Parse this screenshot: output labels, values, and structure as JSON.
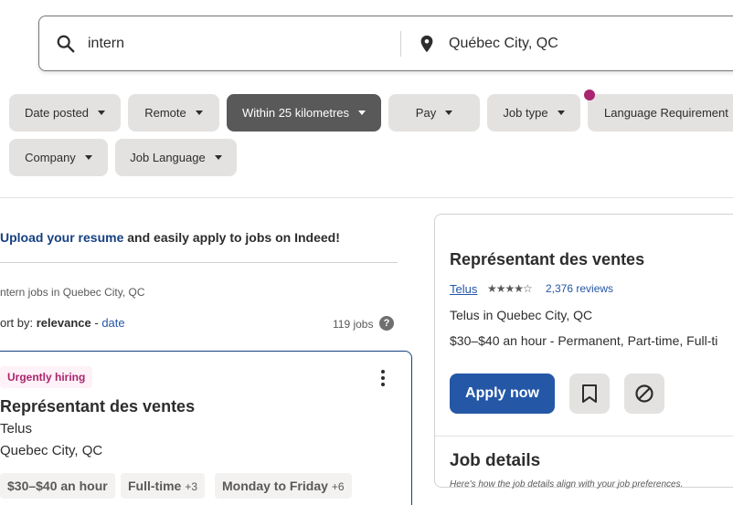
{
  "search": {
    "query": "intern",
    "location": "Québec City, QC"
  },
  "filters": {
    "date_posted": "Date posted",
    "remote": "Remote",
    "distance": "Within 25 kilometres",
    "pay": "Pay",
    "job_type": "Job type",
    "language_requirement": "Language Requirement",
    "company": "Company",
    "job_language": "Job Language"
  },
  "banner": {
    "link": "Upload your resume",
    "text": " and easily apply to jobs on Indeed!"
  },
  "results": {
    "breadcrumb": "ntern jobs in Quebec City, QC",
    "sort_label": "ort by: ",
    "sort_active": "relevance",
    "sort_sep": " - ",
    "sort_alt": "date",
    "count": "119 jobs",
    "help": "?"
  },
  "job_card": {
    "badge": "Urgently hiring",
    "title": "Représentant des ventes",
    "company": "Telus",
    "location": "Quebec City, QC",
    "tags": [
      {
        "label": "$30–$40 an hour",
        "extra": ""
      },
      {
        "label": "Full-time",
        "extra": "+3"
      },
      {
        "label": "Monday to Friday",
        "extra": "+6"
      }
    ]
  },
  "detail_panel": {
    "title": "Représentant des ventes",
    "company": "Telus",
    "stars": "★★★★☆",
    "rating": 4,
    "reviews": "2,376 reviews",
    "location": "Telus in Quebec City, QC",
    "pay": "$30–$40 an hour",
    "job_type": "  - Permanent, Part-time, Full-ti",
    "apply_label": "Apply now",
    "section_title": "Job details",
    "section_sub": "Here's how the job details align with your job preferences."
  },
  "colors": {
    "accent": "#2557a7",
    "active_chip": "#595959",
    "badge": "#a9256e",
    "notification_dot": "#a9256e"
  }
}
